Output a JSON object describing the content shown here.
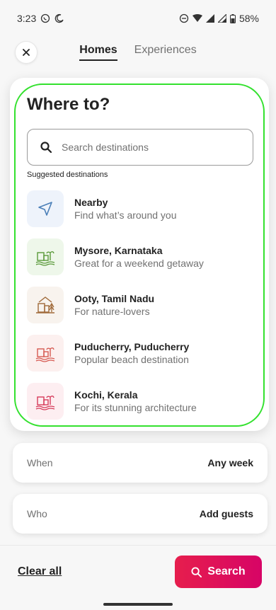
{
  "status_bar": {
    "time": "3:23",
    "battery": "58%"
  },
  "nav": {
    "tabs": [
      {
        "label": "Homes"
      },
      {
        "label": "Experiences"
      }
    ]
  },
  "card": {
    "title": "Where to?",
    "search_placeholder": "Search destinations",
    "suggested_label": "Suggested destinations",
    "destinations": [
      {
        "name": "Nearby",
        "subtitle": "Find what’s around you",
        "icon": "navigation-arrow-icon",
        "color": "#eef3fb"
      },
      {
        "name": "Mysore, Karnataka",
        "subtitle": "Great for a weekend getaway",
        "icon": "lake-buildings-icon",
        "color": "#eef7ea"
      },
      {
        "name": "Ooty, Tamil Nadu",
        "subtitle": "For nature-lovers",
        "icon": "mountain-town-icon",
        "color": "#f8f3ee"
      },
      {
        "name": "Puducherry, Puducherry",
        "subtitle": "Popular beach destination",
        "icon": "beach-palm-icon",
        "color": "#fcf0ef"
      },
      {
        "name": "Kochi, Kerala",
        "subtitle": "For its stunning architecture",
        "icon": "beach-palm-icon",
        "color": "#fdeef1"
      }
    ]
  },
  "when": {
    "label": "When",
    "value": "Any week"
  },
  "who": {
    "label": "Who",
    "value": "Add guests"
  },
  "footer": {
    "clear_all": "Clear all",
    "search_label": "Search"
  },
  "colors": {
    "accent": "#e61e4d",
    "highlight": "#33e12e"
  }
}
